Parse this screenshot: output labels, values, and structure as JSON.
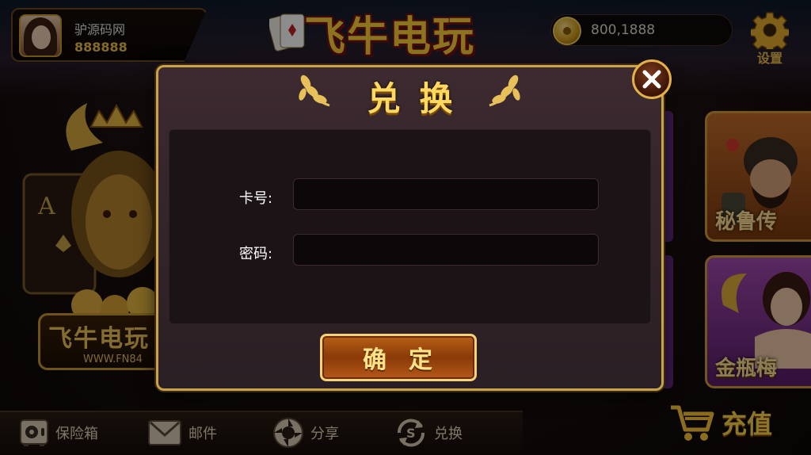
{
  "profile": {
    "name": "驴源码网",
    "id": "888888"
  },
  "header": {
    "logo_text": "飞牛电玩",
    "coins": "800,1888",
    "settings_label": "设置"
  },
  "background": {
    "logo_title": "飞牛电玩",
    "logo_url": "WWW.FN84",
    "game_cards": [
      {
        "label": "秘鲁传"
      },
      {
        "label": "金瓶梅"
      }
    ]
  },
  "bottom_bar": {
    "items": [
      {
        "label": "保险箱",
        "icon": "safe-icon"
      },
      {
        "label": "邮件",
        "icon": "mail-icon"
      },
      {
        "label": "分享",
        "icon": "share-icon"
      },
      {
        "label": "兑换",
        "icon": "exchange-icon"
      }
    ],
    "recharge_label": "充值"
  },
  "modal": {
    "title": "兑换",
    "card_label": "卡号:",
    "card_value": "",
    "password_label": "密码:",
    "password_value": "",
    "confirm_label": "确定"
  },
  "colors": {
    "gold": "#ffd860",
    "frame": "#c9a24a",
    "panel": "#1b1316"
  }
}
